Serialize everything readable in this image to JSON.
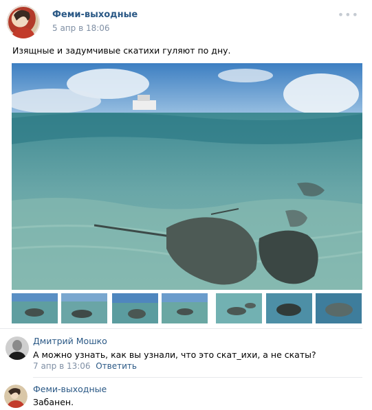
{
  "post": {
    "author": "Феми-выходные",
    "date": "5 апр в 18:06",
    "text": "Изящные и задумчивые скатихи гуляют по дну.",
    "more_icon": "ellipsis-icon",
    "thumbnail_count": 7
  },
  "comments": [
    {
      "author": "Дмитрий Мошко",
      "text": "А можно узнать, как вы узнали, что это скат_ихи, а не скаты?",
      "date": "7 апр в 13:06",
      "reply_label": "Ответить"
    },
    {
      "author": "Феми-выходные",
      "text": "Забанен."
    }
  ],
  "colors": {
    "link": "#2a5885",
    "meta": "#7f8fa4",
    "divider": "#e7e8ec"
  }
}
